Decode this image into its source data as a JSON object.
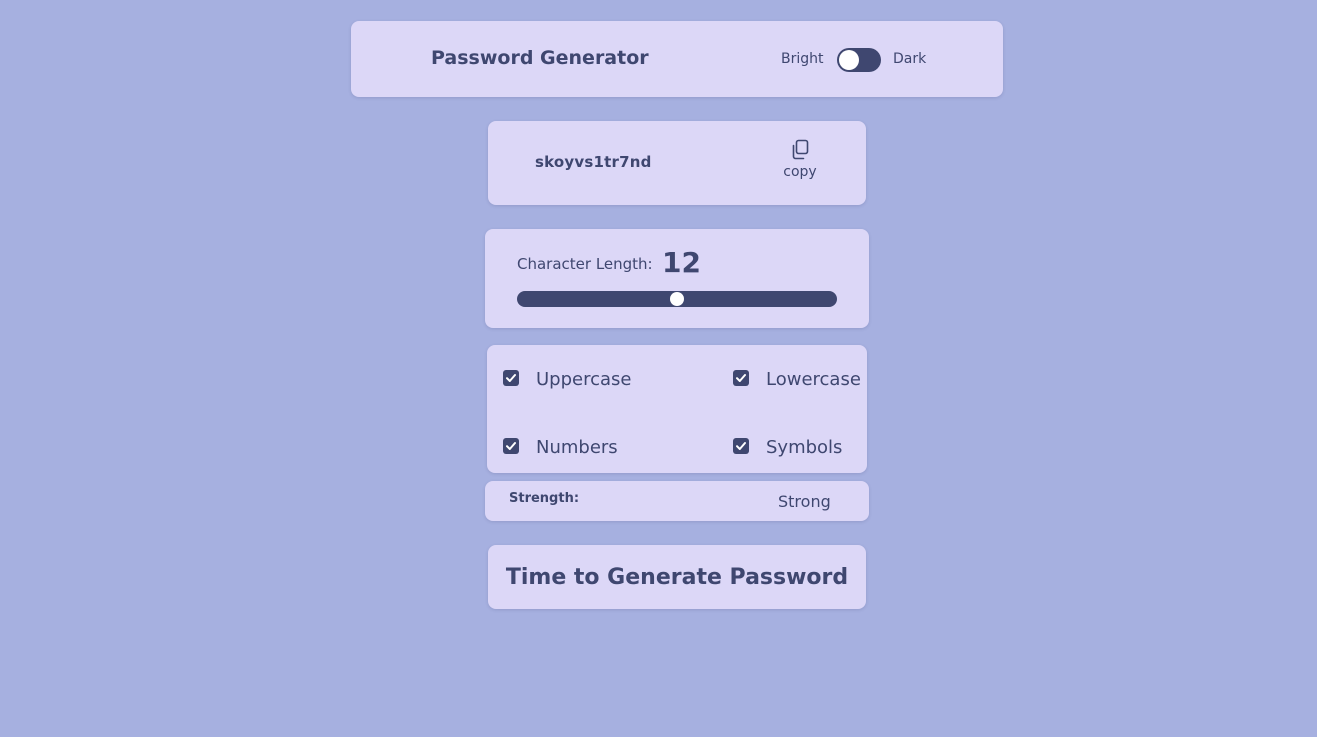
{
  "header": {
    "title": "Password Generator",
    "theme_left_label": "Bright",
    "theme_right_label": "Dark",
    "theme_is_dark": false
  },
  "password": {
    "value": "skoyvs1tr7nd",
    "copy_label": "copy",
    "copy_icon": "copy-icon"
  },
  "length": {
    "label": "Character Length:",
    "value": "12",
    "slider_fraction": 0.5
  },
  "options": {
    "uppercase": {
      "label": "Uppercase",
      "checked": true
    },
    "lowercase": {
      "label": "Lowercase",
      "checked": true
    },
    "numbers": {
      "label": "Numbers",
      "checked": true
    },
    "symbols": {
      "label": "Symbols",
      "checked": true
    }
  },
  "strength": {
    "label": "Strength:",
    "value": "Strong"
  },
  "generate": {
    "label": "Time to Generate Password"
  },
  "colors": {
    "background": "#a6b0e0",
    "card": "#dcd7f7",
    "accent": "#3f4770"
  }
}
